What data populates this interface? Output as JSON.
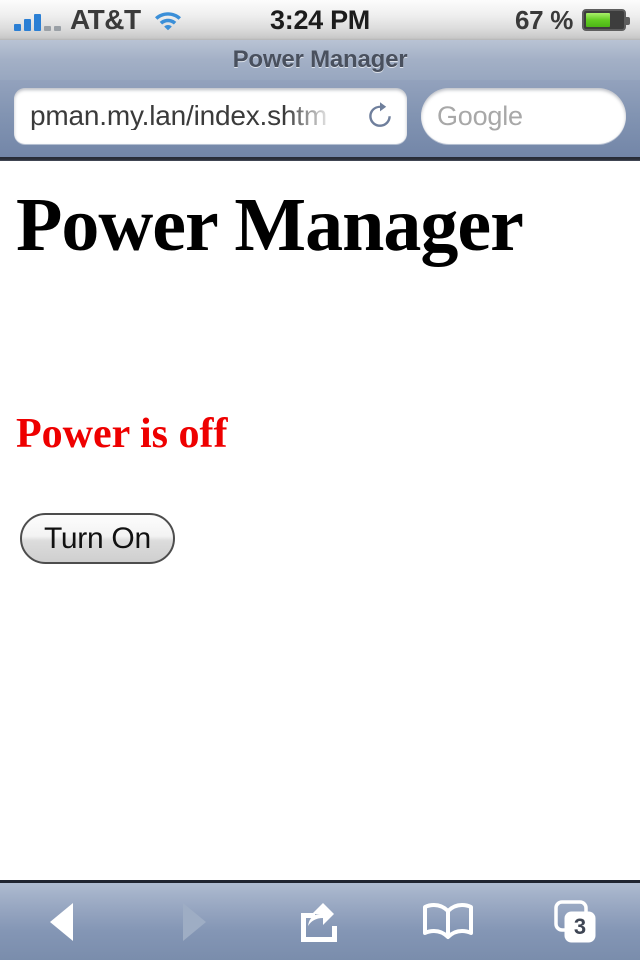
{
  "status_bar": {
    "carrier": "AT&T",
    "signal_icon": "signal-bars-icon",
    "signal_bars_filled": 3,
    "signal_bars_empty": 2,
    "wifi_icon": "wifi-icon",
    "time": "3:24 PM",
    "battery_percent": "67 %",
    "battery_level": 67,
    "battery_icon": "battery-icon",
    "battery_color": "#5fc81e"
  },
  "browser": {
    "page_title": "Power Manager",
    "url": "pman.my.lan/index.shtm",
    "reload_icon": "reload-icon",
    "search_placeholder": "Google",
    "search_value": ""
  },
  "page": {
    "heading": "Power Manager",
    "status_text": "Power is off",
    "status_color": "#ee0000",
    "button_label": "Turn On"
  },
  "toolbar": {
    "back_icon": "back-arrow-icon",
    "back_label": "Back",
    "forward_icon": "forward-arrow-icon",
    "forward_label": "Forward",
    "share_icon": "share-icon",
    "share_label": "Share",
    "bookmarks_icon": "bookmarks-book-icon",
    "bookmarks_label": "Bookmarks",
    "tabs_icon": "tabs-pages-icon",
    "tabs_label": "Tabs",
    "tabs_count": "3"
  }
}
